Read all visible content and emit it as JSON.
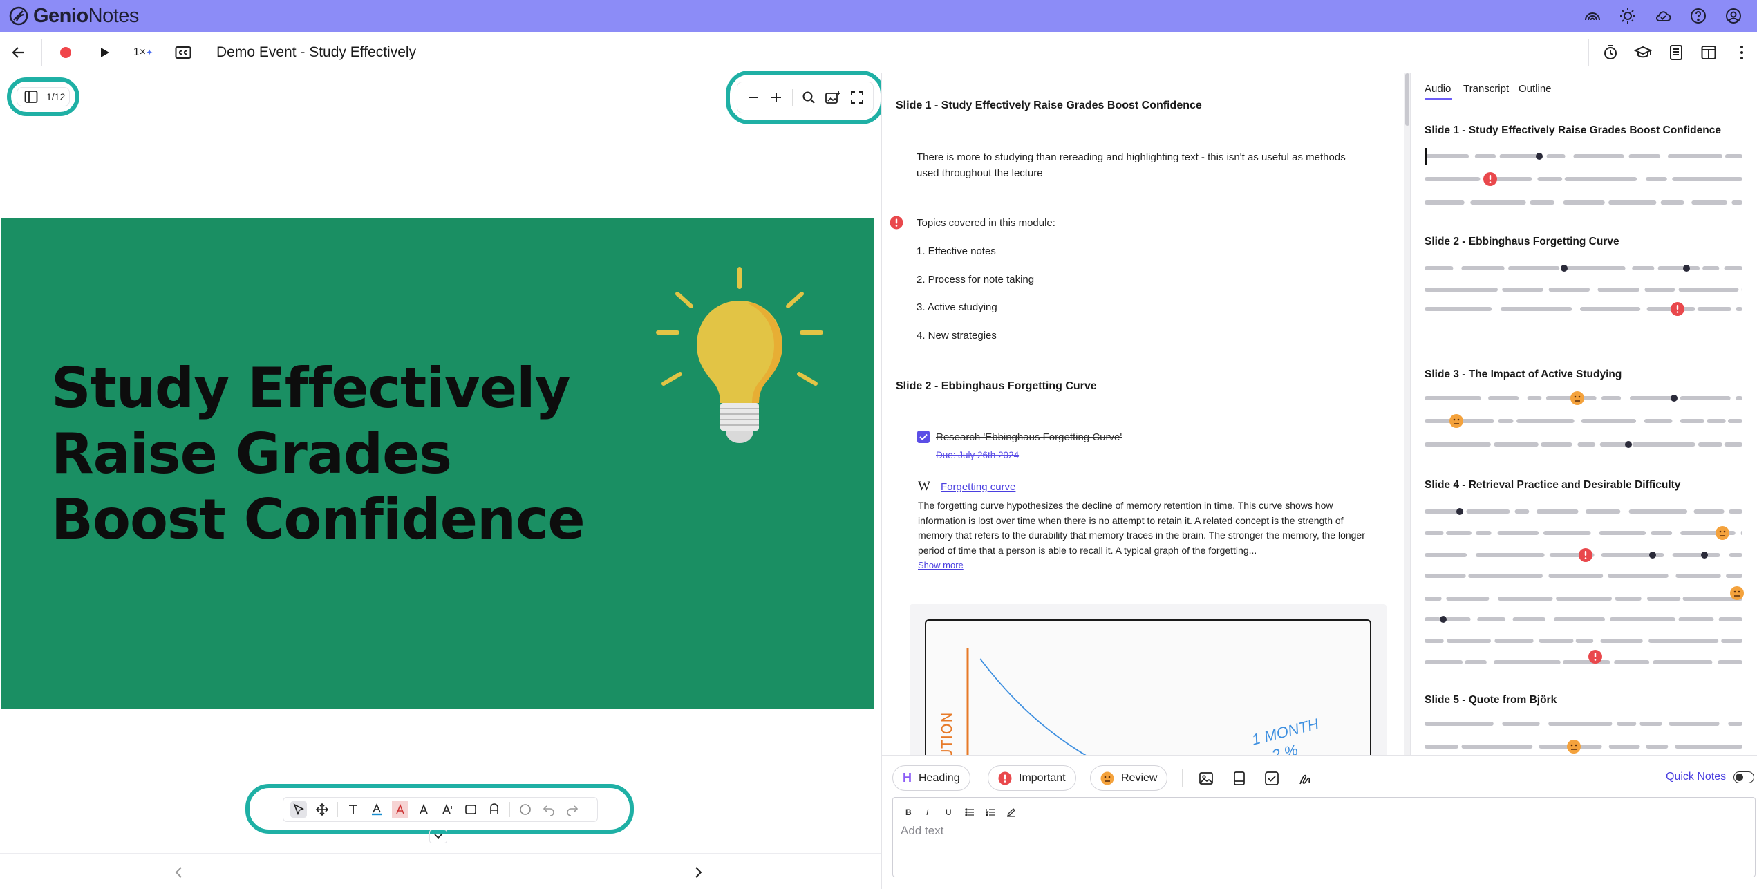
{
  "app": {
    "name_bold": "Genio",
    "name_light": "Notes"
  },
  "toolbar": {
    "speed": "1×",
    "title": "Demo Event - Study Effectively"
  },
  "slide_panel": {
    "page_indicator": "1/12",
    "slide_lines": [
      "Study Effectively",
      "Raise Grades",
      "Boost Confidence"
    ],
    "slide_bg": "#1a8f63"
  },
  "notes": {
    "slide1_title": "Slide 1 - Study Effectively Raise Grades Boost Confidence",
    "slide1_text": "There is more to studying than rereading and highlighting text - this isn't as useful as methods used throughout the lecture",
    "topics_label": "Topics covered in this module:",
    "topics": [
      "1. Effective notes",
      "2. Process for note taking",
      "3. Active studying",
      "4. New strategies"
    ],
    "slide2_title": "Slide 2 - Ebbinghaus Forgetting Curve",
    "task_label": "Research 'Ebbinghaus Forgetting Curve'",
    "task_due": "Due: July 26th 2024",
    "wiki_glyph": "W",
    "wiki_link": "Forgetting curve",
    "wiki_text": "The forgetting curve hypothesizes the decline of memory retention in time. This curve shows how information is lost over time when there is no attempt to retain it. A related concept is the strength of memory that refers to the durability that memory traces in the brain. The stronger the memory, the longer period of time that a person is able to recall it. A typical graph of the forgetting...",
    "show_more": "Show more",
    "sketch_axis_text": "UTION",
    "sketch_note_1": "1 MONTH",
    "sketch_note_2": "2 %"
  },
  "outline": {
    "tabs": [
      "Audio",
      "Transcript",
      "Outline"
    ],
    "active_tab": "Audio",
    "slides": [
      "Slide 1 - Study Effectively Raise Grades Boost Confidence",
      "Slide 2 - Ebbinghaus Forgetting Curve",
      "Slide 3 - The Impact of Active Studying",
      "Slide 4 - Retrieval Practice and Desirable Difficulty",
      "Slide 5 - Quote from Björk"
    ]
  },
  "editor": {
    "heading_label": "Heading",
    "heading_glyph": "H",
    "important_label": "Important",
    "review_label": "Review",
    "quick_notes_label": "Quick Notes",
    "placeholder": "Add text",
    "format_buttons": [
      "B",
      "I",
      "U"
    ]
  },
  "colors": {
    "topbar": "#8c8cf7",
    "accent": "#6b5cf6",
    "highlight_ring": "#1fb0a5",
    "important": "#e9484c"
  },
  "icons": [
    "logo-icon",
    "rainbow-icon",
    "sun-icon",
    "cloud-icon",
    "help-icon",
    "account-icon",
    "back-arrow-icon",
    "record-icon",
    "play-icon",
    "captions-icon",
    "timer-icon",
    "student-cap-icon",
    "notes-icon",
    "layout-icon",
    "more-vertical-icon"
  ]
}
